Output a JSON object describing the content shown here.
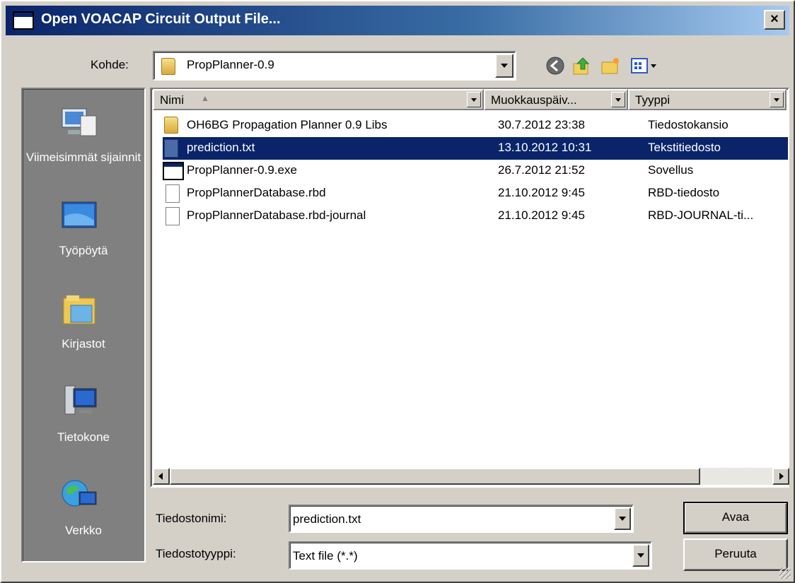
{
  "window": {
    "title": "Open VOACAP Circuit Output File...",
    "close_label": "×"
  },
  "lookin": {
    "label": "Kohde:",
    "value": "PropPlanner-0.9"
  },
  "places": [
    {
      "label": "Viimeisimmät sijainnit",
      "icon": "recent-places-icon"
    },
    {
      "label": "Työpöytä",
      "icon": "desktop-icon"
    },
    {
      "label": "Kirjastot",
      "icon": "libraries-icon"
    },
    {
      "label": "Tietokone",
      "icon": "computer-icon"
    },
    {
      "label": "Verkko",
      "icon": "network-icon"
    }
  ],
  "columns": {
    "name": "Nimi",
    "modified": "Muokkauspäiv...",
    "type": "Tyyppi"
  },
  "files": [
    {
      "name": "OH6BG Propagation Planner 0.9 Libs",
      "modified": "30.7.2012 23:38",
      "type": "Tiedostokansio",
      "icon": "folder-icon"
    },
    {
      "name": "prediction.txt",
      "modified": "13.10.2012 10:31",
      "type": "Tekstitiedosto",
      "icon": "text-file-icon"
    },
    {
      "name": "PropPlanner-0.9.exe",
      "modified": "26.7.2012 21:52",
      "type": "Sovellus",
      "icon": "application-icon"
    },
    {
      "name": "PropPlannerDatabase.rbd",
      "modified": "21.10.2012 9:45",
      "type": "RBD-tiedosto",
      "icon": "file-icon"
    },
    {
      "name": "PropPlannerDatabase.rbd-journal",
      "modified": "21.10.2012 9:45",
      "type": "RBD-JOURNAL-ti...",
      "icon": "file-icon"
    }
  ],
  "selected_file": "prediction.txt",
  "filename": {
    "label": "Tiedostonimi:",
    "value": "prediction.txt"
  },
  "filetype": {
    "label": "Tiedostotyyppi:",
    "value": "Text file (*.*)"
  },
  "buttons": {
    "open": "Avaa",
    "cancel": "Peruuta"
  },
  "colors": {
    "selection": "#0a246a",
    "face": "#d4d0c8",
    "places_bg": "#808080"
  }
}
